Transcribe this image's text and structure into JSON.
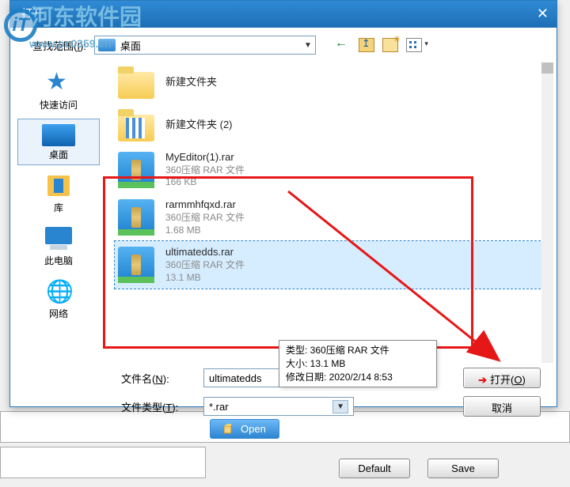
{
  "watermark": {
    "main": "河东软件园",
    "sub": "www.pc0359.cn"
  },
  "bg": {
    "open": "Open",
    "default": "Default",
    "save": "Save"
  },
  "dialog": {
    "title": "打开",
    "lookin_label_pre": "查找范围(",
    "lookin_key": "I",
    "lookin_label_post": "):",
    "lookin_value": "桌面"
  },
  "places": [
    {
      "label": "快速访问",
      "icon": "star"
    },
    {
      "label": "桌面",
      "icon": "desktop",
      "selected": true
    },
    {
      "label": "库",
      "icon": "lib"
    },
    {
      "label": "此电脑",
      "icon": "pc"
    },
    {
      "label": "网络",
      "icon": "net"
    }
  ],
  "files": [
    {
      "name": "新建文件夹",
      "kind": "folder"
    },
    {
      "name": "新建文件夹 (2)",
      "kind": "folder2"
    },
    {
      "name": "MyEditor(1).rar",
      "type": "360压缩 RAR 文件",
      "size": "166 KB",
      "kind": "rar"
    },
    {
      "name": "rarmmhfqxd.rar",
      "type": "360压缩 RAR 文件",
      "size": "1.68 MB",
      "kind": "rar"
    },
    {
      "name": "ultimatedds.rar",
      "type": "360压缩 RAR 文件",
      "size": "13.1 MB",
      "kind": "rar",
      "selected": true
    }
  ],
  "tooltip": {
    "l1_label": "类型: ",
    "l1_value": "360压缩 RAR 文件",
    "l2_label": "大小: ",
    "l2_value": "13.1 MB",
    "l3_label": "修改日期: ",
    "l3_value": "2020/2/14 8:53"
  },
  "fields": {
    "filename_label_pre": "文件名(",
    "filename_key": "N",
    "filename_label_post": "):",
    "filename_value": "ultimatedds",
    "filetype_label_pre": "文件类型(",
    "filetype_key": "T",
    "filetype_label_post": "):",
    "filetype_value": "*.rar",
    "open_pre": "打开(",
    "open_key": "O",
    "open_post": ")",
    "cancel": "取消"
  }
}
